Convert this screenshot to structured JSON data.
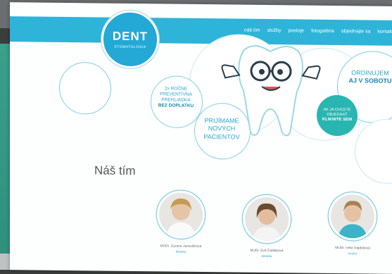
{
  "logo": {
    "main": "DENT",
    "sub": "STOMATOLÓGIA"
  },
  "nav": {
    "items": [
      "náš tím",
      "služby",
      "postoje",
      "fotogaléria",
      "objednajte sa",
      "kontakt"
    ]
  },
  "bubbles": {
    "left": [
      "2x ROČNE",
      "PREVENTÍVNA",
      "PREHLIADKA",
      "BEZ DOPLATKU"
    ],
    "center": [
      "PRIJÍMAME",
      "NOVÝCH",
      "PACIENTOV"
    ],
    "right": [
      "ORDINUJEM",
      "AJ V SOBOTU"
    ],
    "cta": [
      "AK JA CHCETE",
      "OBJEDNAŤ",
      "KLIKNITE SEM"
    ]
  },
  "team": {
    "title": "Náš tím",
    "members": [
      {
        "name": "MUDr. Zuzana Janovičková",
        "role": "lekárka"
      },
      {
        "name": "MUDr. Eva Čalábková",
        "role": "lekárka"
      },
      {
        "name": "MUDr. Iveta Gajdošová",
        "role": "sestra"
      }
    ]
  },
  "colors": {
    "brand": "#24a8d6",
    "accent": "#29b5b0",
    "nav_bg": "#2db4d8"
  }
}
